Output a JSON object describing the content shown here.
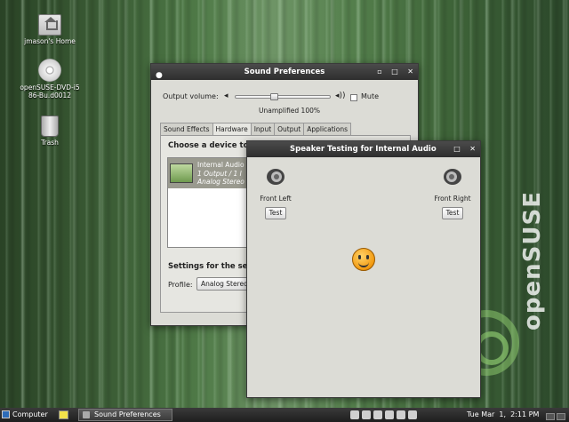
{
  "desktop": {
    "icons": [
      {
        "label": "jmason's Home",
        "icon": "home-folder-icon"
      },
      {
        "label": "openSUSE-DVD-i586-Bu.d0012",
        "icon": "disc-icon"
      },
      {
        "label": "Trash",
        "icon": "trash-icon"
      }
    ],
    "brand_text": "openSUSE"
  },
  "sound_window": {
    "title": "Sound Preferences",
    "output_volume_label": "Output volume:",
    "mute_label": "Mute",
    "volume_status": "Unamplified 100%",
    "volume_fraction": 0.4,
    "tabs": [
      "Sound Effects",
      "Hardware",
      "Input",
      "Output",
      "Applications"
    ],
    "active_tab": "Hardware",
    "choose_device_label": "Choose a device to",
    "device": {
      "name": "Internal Audio",
      "io": "1 Output / 1 I",
      "profile": "Analog Stereo"
    },
    "settings_label": "Settings for the se",
    "profile_label": "Profile:",
    "profile_value": "Analog Stereo"
  },
  "speaker_window": {
    "title": "Speaker Testing for Internal Audio",
    "speakers": [
      {
        "label": "Front Left",
        "button": "Test"
      },
      {
        "label": "Front Right",
        "button": "Test"
      }
    ]
  },
  "taskbar": {
    "start_label": "Computer",
    "task_label": "Sound Preferences",
    "clock": "Tue Mar  1,  2:11 PM"
  },
  "colors": {
    "titlebar": "#2e2e2e",
    "window_bg": "#dcdcd6",
    "desktop_green": "#4f7a47"
  }
}
